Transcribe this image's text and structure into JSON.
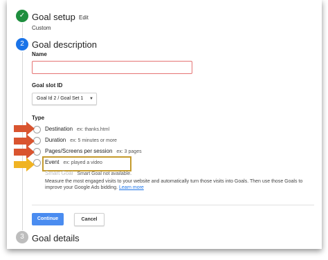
{
  "steps": {
    "setup": {
      "number": "✓",
      "title": "Goal setup",
      "edit_label": "Edit",
      "subtitle": "Custom"
    },
    "description": {
      "number": "2",
      "title": "Goal description"
    },
    "details": {
      "number": "3",
      "title": "Goal details"
    }
  },
  "form": {
    "name_label": "Name",
    "name_value": "",
    "slot_label": "Goal slot ID",
    "slot_value": "Goal Id 2 / Goal Set 1",
    "type_label": "Type",
    "options": [
      {
        "label": "Destination",
        "example": "ex: thanks.html"
      },
      {
        "label": "Duration",
        "example": "ex: 5 minutes or more"
      },
      {
        "label": "Pages/Screens per session",
        "example": "ex: 3 pages"
      },
      {
        "label": "Event",
        "example": "ex: played a video"
      }
    ],
    "smart_goal": {
      "label": "Smart Goal",
      "note": "Smart Goal not available."
    },
    "description_text": "Measure the most engaged visits to your website and automatically turn those visits into Goals. Then use those Goals to improve your Google Ads bidding.",
    "learn_more": "Learn more"
  },
  "buttons": {
    "continue": "Continue",
    "cancel": "Cancel"
  },
  "colors": {
    "arrow_red": "#d9542f",
    "arrow_yellow": "#f0b323",
    "highlight_border": "#c49a2c",
    "primary": "#4a8cf0"
  }
}
